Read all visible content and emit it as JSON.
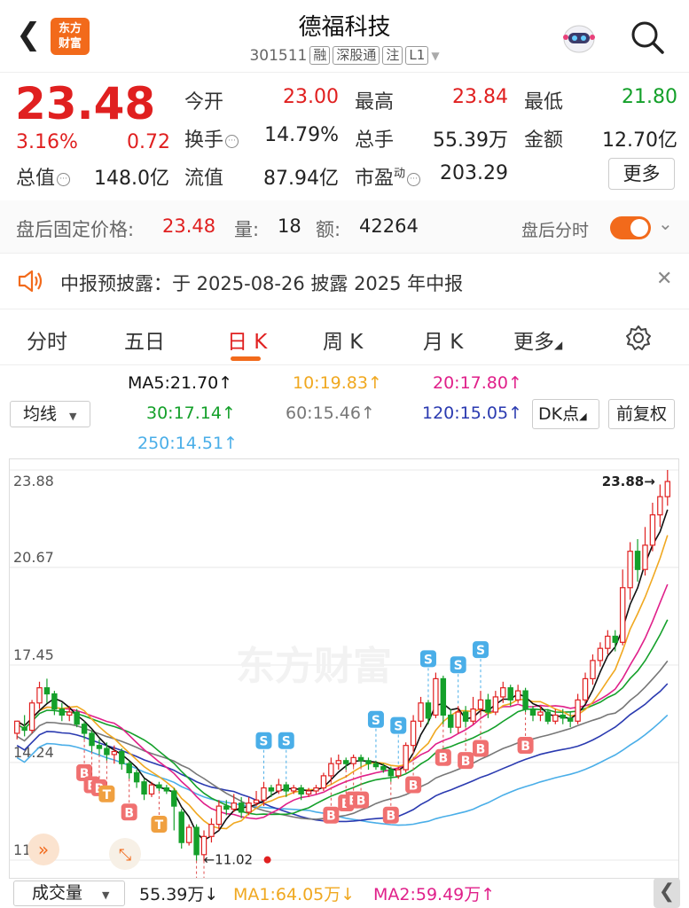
{
  "header": {
    "stock_name": "德福科技",
    "code": "301511",
    "tags": [
      "融",
      "深股通",
      "注",
      "L1"
    ],
    "logo_line1": "东方",
    "logo_line2": "财富"
  },
  "quote": {
    "price": "23.48",
    "change_pct": "3.16%",
    "change": "0.72",
    "open_label": "今开",
    "open": "23.00",
    "high_label": "最高",
    "high": "23.84",
    "low_label": "最低",
    "low": "21.80",
    "turnover_label": "换手",
    "turnover": "14.79%",
    "volume_label": "总手",
    "volume": "55.39万",
    "amount_label": "金额",
    "amount": "12.70亿",
    "mcap_label": "总值",
    "mcap": "148.0亿",
    "float_label": "流值",
    "float_cap": "87.94亿",
    "pe_label": "市盈",
    "pe_sup": "动",
    "pe": "203.29",
    "more_button": "更多"
  },
  "post_trading": {
    "price_label": "盘后固定价格:",
    "price": "23.48",
    "vol_label": "量:",
    "vol": "18",
    "amt_label": "额:",
    "amt": "42264",
    "toggle_label": "盘后分时",
    "toggle_on": true
  },
  "notice": {
    "text": "中报预披露：于 2025-08-26 披露 2025 年中报"
  },
  "tabs": [
    "分时",
    "五日",
    "日 K",
    "周 K",
    "月 K",
    "更多"
  ],
  "active_tab": 2,
  "ma_panel": {
    "select_label": "均线",
    "ma5": "MA5:21.70",
    "ma10": "10:19.83",
    "ma20": "20:17.80",
    "ma30": "30:17.14",
    "ma60": "60:15.46",
    "ma120": "120:15.05",
    "ma250": "250:14.51",
    "dk_label": "DK点",
    "adjust_label": "前复权"
  },
  "colors": {
    "up": "#e02020",
    "down": "#14a02a",
    "ma5": "#111111",
    "ma10": "#f0a820",
    "ma20": "#e0208a",
    "ma30": "#14a02a",
    "ma60": "#777777",
    "ma120": "#2a3ab0",
    "ma250": "#4aaee8",
    "accent": "#f26a1b"
  },
  "chart_data": {
    "type": "candlestick",
    "ylim": [
      11.02,
      23.88
    ],
    "y_ticks": [
      "23.88",
      "20.67",
      "17.45",
      "14.24",
      "11.02"
    ],
    "max_label": "23.88",
    "min_label": "11.02",
    "watermark": "东方财富",
    "candles": [
      [
        15.2,
        15.6,
        15.0,
        15.4
      ],
      [
        15.4,
        15.3,
        15.1,
        15.8
      ],
      [
        15.3,
        16.2,
        15.2,
        16.3
      ],
      [
        16.2,
        16.7,
        16.0,
        16.9
      ],
      [
        16.7,
        16.5,
        16.2,
        17.0
      ],
      [
        16.5,
        16.0,
        15.8,
        16.6
      ],
      [
        16.0,
        15.8,
        15.6,
        16.2
      ],
      [
        15.8,
        15.9,
        15.6,
        16.1
      ],
      [
        15.9,
        15.5,
        15.4,
        16.0
      ],
      [
        15.5,
        15.2,
        15.0,
        15.6
      ],
      [
        15.2,
        14.8,
        14.6,
        15.3
      ],
      [
        14.8,
        14.7,
        14.5,
        15.0
      ],
      [
        14.7,
        14.5,
        14.3,
        14.9
      ],
      [
        14.5,
        14.6,
        14.2,
        14.8
      ],
      [
        14.6,
        14.2,
        14.0,
        14.7
      ],
      [
        14.2,
        13.9,
        13.7,
        14.3
      ],
      [
        13.9,
        13.6,
        13.4,
        14.0
      ],
      [
        13.6,
        13.2,
        13.0,
        13.7
      ],
      [
        13.2,
        13.5,
        13.1,
        13.6
      ],
      [
        13.5,
        13.4,
        13.3,
        13.6
      ],
      [
        13.4,
        13.3,
        13.2,
        13.5
      ],
      [
        13.3,
        12.8,
        12.0,
        13.4
      ],
      [
        12.6,
        11.6,
        11.4,
        12.7
      ],
      [
        11.6,
        12.1,
        11.5,
        12.2
      ],
      [
        12.1,
        11.2,
        11.0,
        12.2
      ],
      [
        11.2,
        11.8,
        11.0,
        12.0
      ],
      [
        11.8,
        12.2,
        11.6,
        12.4
      ],
      [
        12.2,
        12.8,
        12.0,
        13.0
      ],
      [
        12.8,
        12.7,
        12.5,
        13.0
      ],
      [
        12.7,
        12.9,
        12.6,
        13.2
      ],
      [
        12.9,
        12.6,
        12.4,
        13.1
      ],
      [
        12.6,
        12.9,
        12.5,
        13.1
      ],
      [
        12.9,
        13.0,
        12.8,
        13.3
      ],
      [
        13.0,
        13.4,
        12.8,
        13.6
      ],
      [
        13.4,
        13.3,
        13.1,
        13.5
      ],
      [
        13.3,
        13.5,
        13.2,
        13.7
      ],
      [
        13.5,
        13.3,
        13.1,
        13.6
      ],
      [
        13.3,
        13.4,
        13.2,
        13.5
      ],
      [
        13.4,
        13.2,
        13.0,
        13.5
      ],
      [
        13.2,
        13.3,
        13.1,
        13.4
      ],
      [
        13.3,
        13.4,
        13.2,
        13.5
      ],
      [
        13.4,
        13.8,
        13.3,
        13.9
      ],
      [
        13.8,
        14.2,
        13.6,
        14.4
      ],
      [
        14.2,
        14.3,
        14.0,
        14.5
      ],
      [
        14.3,
        14.2,
        14.0,
        14.4
      ],
      [
        14.2,
        14.4,
        14.1,
        14.5
      ],
      [
        14.4,
        14.3,
        14.1,
        14.5
      ],
      [
        14.3,
        14.2,
        14.0,
        14.4
      ],
      [
        14.2,
        14.1,
        14.0,
        14.3
      ],
      [
        14.1,
        14.0,
        13.9,
        14.2
      ],
      [
        14.0,
        13.8,
        13.6,
        14.1
      ],
      [
        13.8,
        14.0,
        13.7,
        14.1
      ],
      [
        14.0,
        14.8,
        13.9,
        14.9
      ],
      [
        14.8,
        15.6,
        14.6,
        15.8
      ],
      [
        15.6,
        16.2,
        15.4,
        16.4
      ],
      [
        16.2,
        15.7,
        15.5,
        16.3
      ],
      [
        15.8,
        17.0,
        15.7,
        17.2
      ],
      [
        17.0,
        15.8,
        15.5,
        17.1
      ],
      [
        15.8,
        15.4,
        15.2,
        16.0
      ],
      [
        15.4,
        15.9,
        15.2,
        16.1
      ],
      [
        15.9,
        15.6,
        15.4,
        16.1
      ],
      [
        15.6,
        16.0,
        15.5,
        16.4
      ],
      [
        16.0,
        16.3,
        15.8,
        16.6
      ],
      [
        16.3,
        15.9,
        15.7,
        16.5
      ],
      [
        15.9,
        16.4,
        15.8,
        16.6
      ],
      [
        16.4,
        16.7,
        16.2,
        16.9
      ],
      [
        16.7,
        16.3,
        16.1,
        16.8
      ],
      [
        16.3,
        16.6,
        16.2,
        16.8
      ],
      [
        16.6,
        16.0,
        15.9,
        16.7
      ],
      [
        16.0,
        15.8,
        15.6,
        16.1
      ],
      [
        15.8,
        15.9,
        15.6,
        16.1
      ],
      [
        15.9,
        15.6,
        15.5,
        16.0
      ],
      [
        15.6,
        15.8,
        15.5,
        16.0
      ],
      [
        15.8,
        15.7,
        15.5,
        16.0
      ],
      [
        15.7,
        15.6,
        15.4,
        15.9
      ],
      [
        15.6,
        16.3,
        15.5,
        16.5
      ],
      [
        16.3,
        17.0,
        16.2,
        17.2
      ],
      [
        17.0,
        17.6,
        16.8,
        17.8
      ],
      [
        17.6,
        18.0,
        17.4,
        18.2
      ],
      [
        18.0,
        18.4,
        17.8,
        18.6
      ],
      [
        18.4,
        18.2,
        17.9,
        18.6
      ],
      [
        18.2,
        20.0,
        18.1,
        20.6
      ],
      [
        20.0,
        21.2,
        19.6,
        21.5
      ],
      [
        21.2,
        20.6,
        20.2,
        21.6
      ],
      [
        20.6,
        21.4,
        20.4,
        22.0
      ],
      [
        21.4,
        22.4,
        21.2,
        22.8
      ],
      [
        22.4,
        23.0,
        22.0,
        23.4
      ],
      [
        23.0,
        23.5,
        22.7,
        23.88
      ]
    ],
    "bs_markers": [
      {
        "label": "B"
      },
      {
        "label": "B"
      },
      {
        "label": "B"
      },
      {
        "label": "T"
      },
      {
        "label": "B"
      },
      {
        "label": "T"
      },
      {
        "label": "B"
      },
      {
        "label": "B"
      },
      {
        "label": "S"
      },
      {
        "label": "S"
      },
      {
        "label": "B"
      },
      {
        "label": "B"
      },
      {
        "label": "B"
      },
      {
        "label": "B"
      },
      {
        "label": "S"
      },
      {
        "label": "B"
      },
      {
        "label": "S"
      },
      {
        "label": "B"
      },
      {
        "label": "S"
      },
      {
        "label": "B"
      },
      {
        "label": "S"
      },
      {
        "label": "B"
      },
      {
        "label": "S"
      },
      {
        "label": "B"
      },
      {
        "label": "B"
      }
    ]
  },
  "volume_bar": {
    "select_label": "成交量",
    "vol": "55.39万",
    "ma1": "MA1:64.05万",
    "ma2": "MA2:59.49万"
  }
}
